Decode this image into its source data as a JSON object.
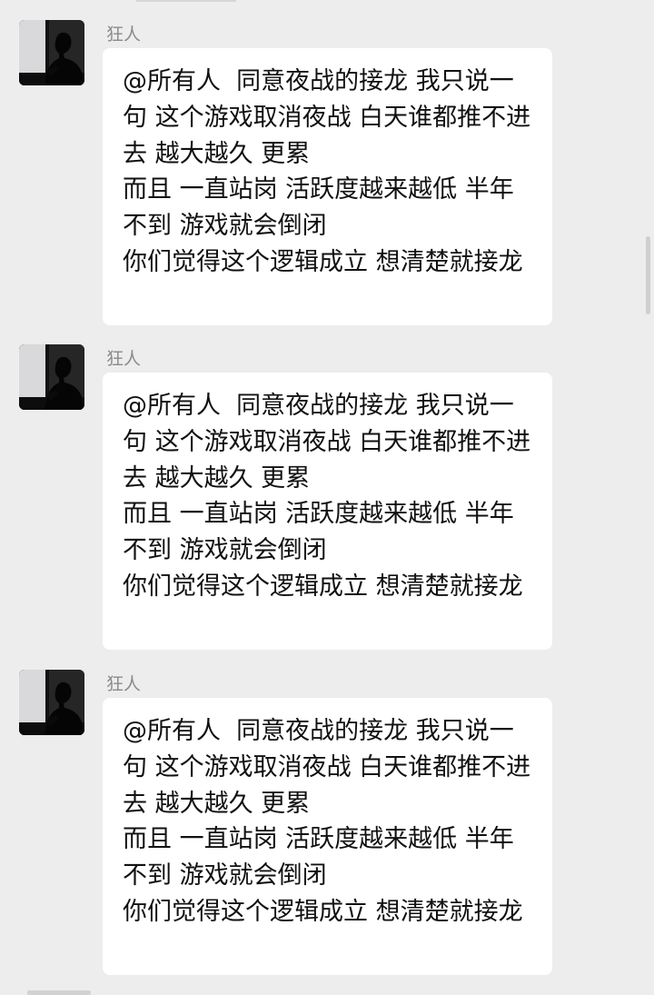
{
  "chat": {
    "messages": [
      {
        "sender": "狂人",
        "avatar_icon": "user-avatar-silhouette",
        "text": "@所有人  同意夜战的接龙 我只说一句 这个游戏取消夜战 白天谁都推不进去 越大越久 更累\n而且 一直站岗 活跃度越来越低 半年不到 游戏就会倒闭\n你们觉得这个逻辑成立 想清楚就接龙"
      },
      {
        "sender": "狂人",
        "avatar_icon": "user-avatar-silhouette",
        "text": "@所有人  同意夜战的接龙 我只说一句 这个游戏取消夜战 白天谁都推不进去 越大越久 更累\n而且 一直站岗 活跃度越来越低 半年不到 游戏就会倒闭\n你们觉得这个逻辑成立 想清楚就接龙"
      },
      {
        "sender": "狂人",
        "avatar_icon": "user-avatar-silhouette",
        "text": "@所有人  同意夜战的接龙 我只说一句 这个游戏取消夜战 白天谁都推不进去 越大越久 更累\n而且 一直站岗 活跃度越来越低 半年不到 游戏就会倒闭\n你们觉得这个逻辑成立 想清楚就接龙"
      }
    ]
  },
  "colors": {
    "background": "#ededed",
    "bubble": "#ffffff",
    "sender_name": "#8a8a8a",
    "message_text": "#111111"
  }
}
